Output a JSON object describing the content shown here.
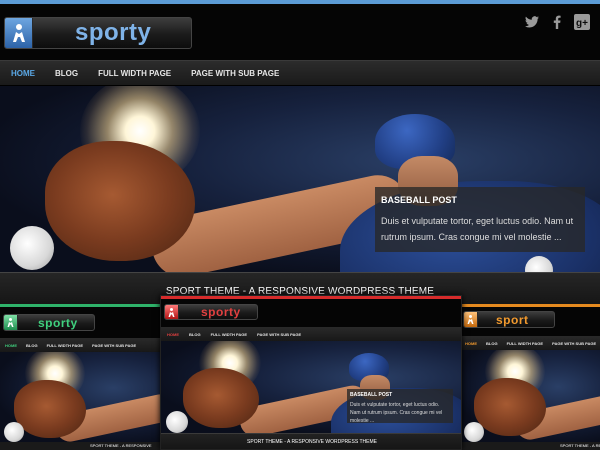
{
  "main": {
    "logo_text": "sporty",
    "nav": [
      {
        "label": "HOME",
        "active": true
      },
      {
        "label": "BLOG",
        "active": false
      },
      {
        "label": "FULL WIDTH PAGE",
        "active": false
      },
      {
        "label": "PAGE WITH SUB PAGE",
        "active": false
      }
    ],
    "social": [
      {
        "icon": "twitter-icon"
      },
      {
        "icon": "facebook-icon"
      },
      {
        "icon": "google-plus-icon"
      }
    ],
    "slider": {
      "title": "BASEBALL POST",
      "text": "Duis et vulputate tortor, eget luctus odio. Nam ut rutrum ipsum. Cras congue mi vel molestie  ..."
    },
    "tagline": "SPORT THEME - A RESPONSIVE WORDPRESS THEME"
  },
  "previews": {
    "left": {
      "logo_text": "sporty",
      "accent": "#2fb36a",
      "nav": [
        "HOME",
        "BLOG",
        "FULL WIDTH PAGE",
        "PAGE WITH SUB PAGE"
      ],
      "tagline": "SPORT THEME - A RESPONSIVE"
    },
    "center": {
      "logo_text": "sporty",
      "accent": "#d62b2b",
      "nav": [
        "HOME",
        "BLOG",
        "FULL WIDTH PAGE",
        "PAGE WITH SUB PAGE"
      ],
      "slider_title": "BASEBALL POST",
      "slider_text": "Duis et vulputate tortor, eget luctus odio. Nam ut rutrum ipsum. Cras congue mi vel molestie  ...",
      "tagline": "SPORT THEME - A RESPONSIVE WORDPRESS THEME"
    },
    "right": {
      "logo_text": "sport",
      "accent": "#e58a1f",
      "nav": [
        "HOME",
        "BLOG",
        "FULL WIDTH PAGE",
        "PAGE WITH SUB PAGE"
      ],
      "tagline": "SPORT THEME - A RES"
    }
  },
  "colors": {
    "main_accent": "#5b9bd5",
    "nav_active": "#5aa8e6"
  }
}
